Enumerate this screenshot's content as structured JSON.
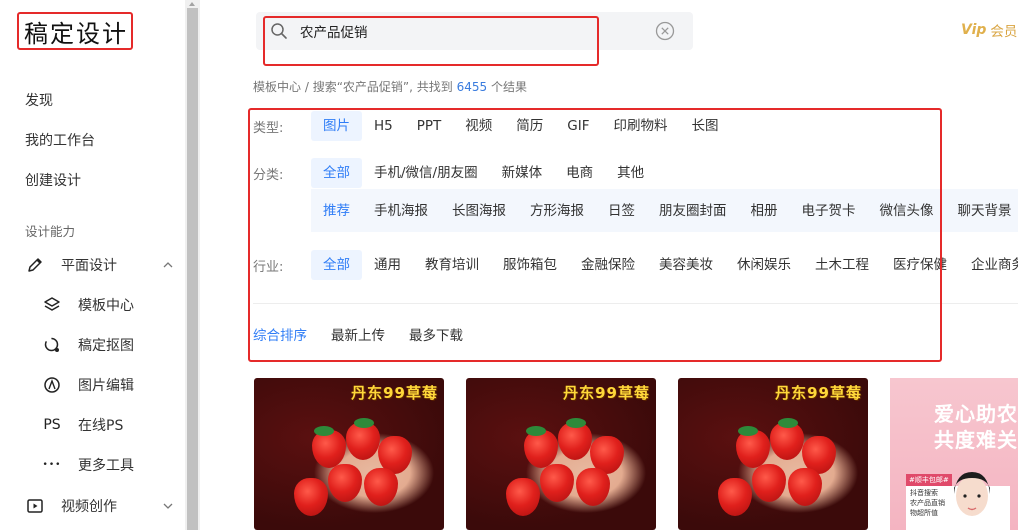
{
  "app": {
    "logo": "稿定设计"
  },
  "sidebar": {
    "top_items": [
      "发现",
      "我的工作台",
      "创建设计"
    ],
    "section_title": "设计能力",
    "group_graphic": {
      "label": "平面设计",
      "icon": "pen-icon",
      "expanded": true
    },
    "sub_items": [
      {
        "label": "模板中心",
        "icon": "layers-icon"
      },
      {
        "label": "稿定抠图",
        "icon": "cutout-icon"
      },
      {
        "label": "图片编辑",
        "icon": "edit-image-icon"
      },
      {
        "label": "在线PS",
        "icon": "ps-icon",
        "icon_text": "PS"
      },
      {
        "label": "更多工具",
        "icon": "more-dots-icon",
        "icon_text": "•••"
      }
    ],
    "group_video": {
      "label": "视频创作",
      "icon": "video-icon",
      "expanded": false
    }
  },
  "search": {
    "value": "农产品促销",
    "placeholder": ""
  },
  "vip": {
    "label": "会员",
    "icon_text": "Vip"
  },
  "breadcrumb": {
    "root": "模板中心",
    "sep": " / ",
    "prefix": "搜索“农产品促销”, 共找到 ",
    "count": "6455",
    "suffix": " 个结果"
  },
  "filters": {
    "type": {
      "label": "类型:",
      "options": [
        "图片",
        "H5",
        "PPT",
        "视频",
        "简历",
        "GIF",
        "印刷物料",
        "长图"
      ],
      "active": 0
    },
    "category": {
      "label": "分类:",
      "options": [
        "全部",
        "手机/微信/朋友圈",
        "新媒体",
        "电商",
        "其他"
      ],
      "active": 0
    },
    "subcategory": {
      "options": [
        "推荐",
        "手机海报",
        "长图海报",
        "方形海报",
        "日签",
        "朋友圈封面",
        "相册",
        "电子贺卡",
        "微信头像",
        "聊天背景"
      ],
      "active": 0
    },
    "industry": {
      "label": "行业:",
      "options": [
        "全部",
        "通用",
        "教育培训",
        "服饰箱包",
        "金融保险",
        "美容美妆",
        "休闲娱乐",
        "土木工程",
        "医疗保健",
        "企业商务"
      ],
      "active": 0
    }
  },
  "sort": {
    "options": [
      "综合排序",
      "最新上传",
      "最多下载"
    ],
    "active": 0
  },
  "cards": [
    {
      "title": "丹东99草莓"
    },
    {
      "title": "丹东99草莓"
    },
    {
      "title": "丹东99草莓"
    }
  ],
  "pink_card": {
    "line1": "爱心助农",
    "line2": "共度难关",
    "badge": "#顺丰包邮#",
    "text": "抖音搜索 农产品直销 物超所值"
  },
  "colors": {
    "accent": "#2f7df6",
    "annotation": "#e52a2a",
    "vip": "#d9a441"
  }
}
